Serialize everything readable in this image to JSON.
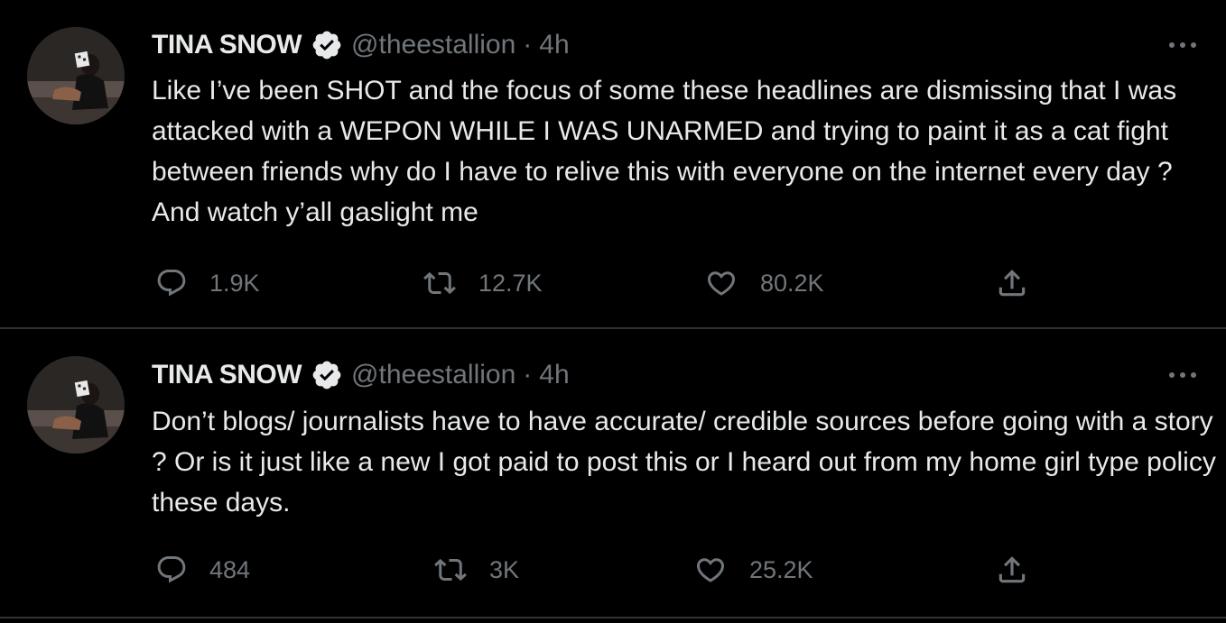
{
  "tweets": [
    {
      "name": "TINA SNOW",
      "handle": "@theestallion",
      "separator": "·",
      "time": "4h",
      "text": "Like I’ve been SHOT and the focus of some these headlines are dismissing that I was attacked with a WEPON WHILE I WAS UNARMED and trying to paint it as a cat fight between friends why do I have to relive this with everyone on the internet every day ? And watch y’all gaslight me",
      "replies": "1.9K",
      "retweets": "12.7K",
      "likes": "80.2K"
    },
    {
      "name": "TINA SNOW",
      "handle": "@theestallion",
      "separator": "·",
      "time": "4h",
      "text": "Don’t blogs/ journalists have to have accurate/ credible sources before going with a story ? Or is it just like a new I got paid to post this or I heard out from my home girl type policy these days.",
      "replies": "484",
      "retweets": "3K",
      "likes": "25.2K"
    }
  ],
  "icons": {
    "verified": "verified-badge-icon",
    "more": "more-dots-icon",
    "reply": "reply-icon",
    "retweet": "retweet-icon",
    "like": "heart-icon",
    "share": "share-icon"
  },
  "colors": {
    "background": "#000000",
    "text": "#e7e9ea",
    "secondary": "#71767b",
    "divider": "#2f3336"
  }
}
